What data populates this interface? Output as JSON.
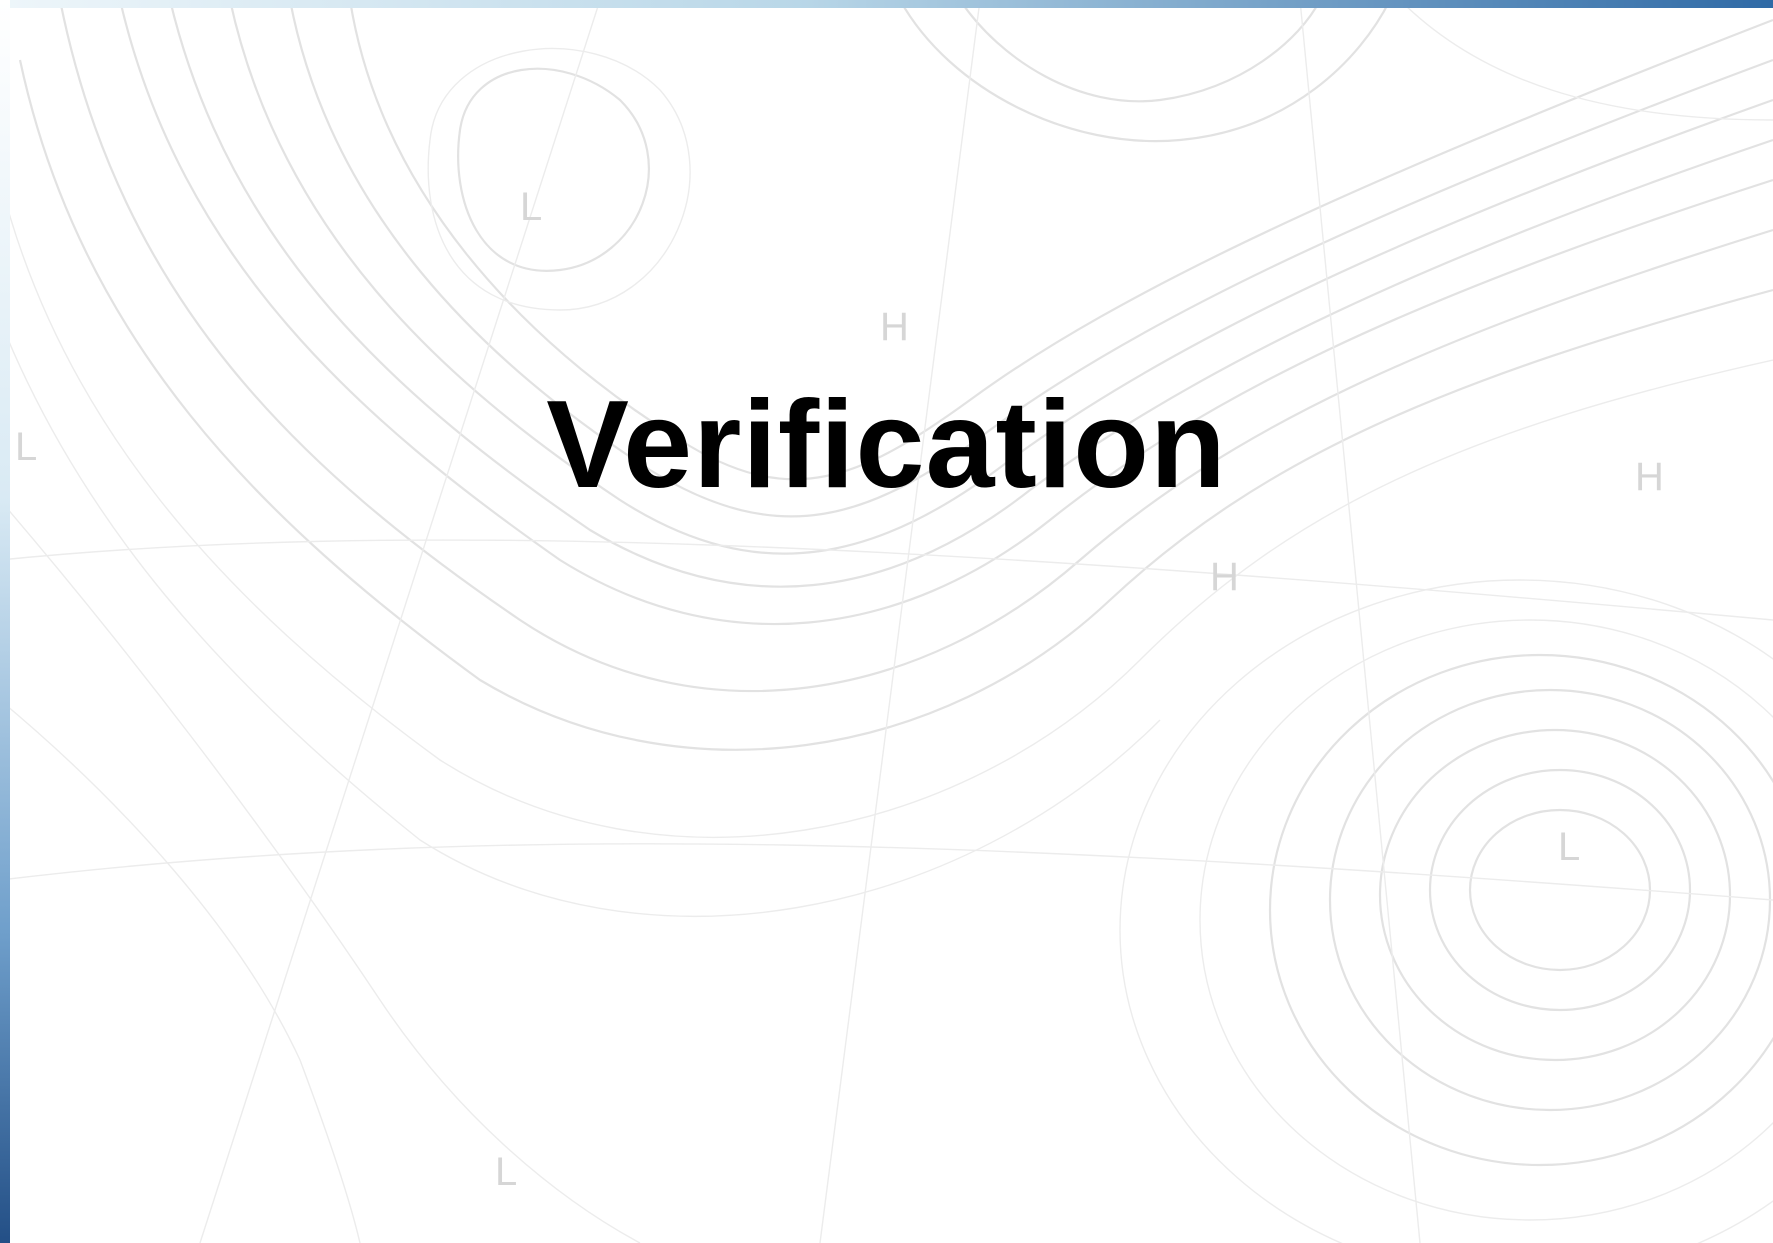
{
  "slide": {
    "title": "Verification"
  },
  "background": {
    "map_symbols": [
      "L",
      "H",
      "L",
      "H",
      "H",
      "L",
      "L"
    ]
  },
  "colors": {
    "title": "#000000",
    "background": "#ffffff",
    "contour_lines": "#e2e2e2",
    "accent_blue": "#2f6aa6"
  }
}
